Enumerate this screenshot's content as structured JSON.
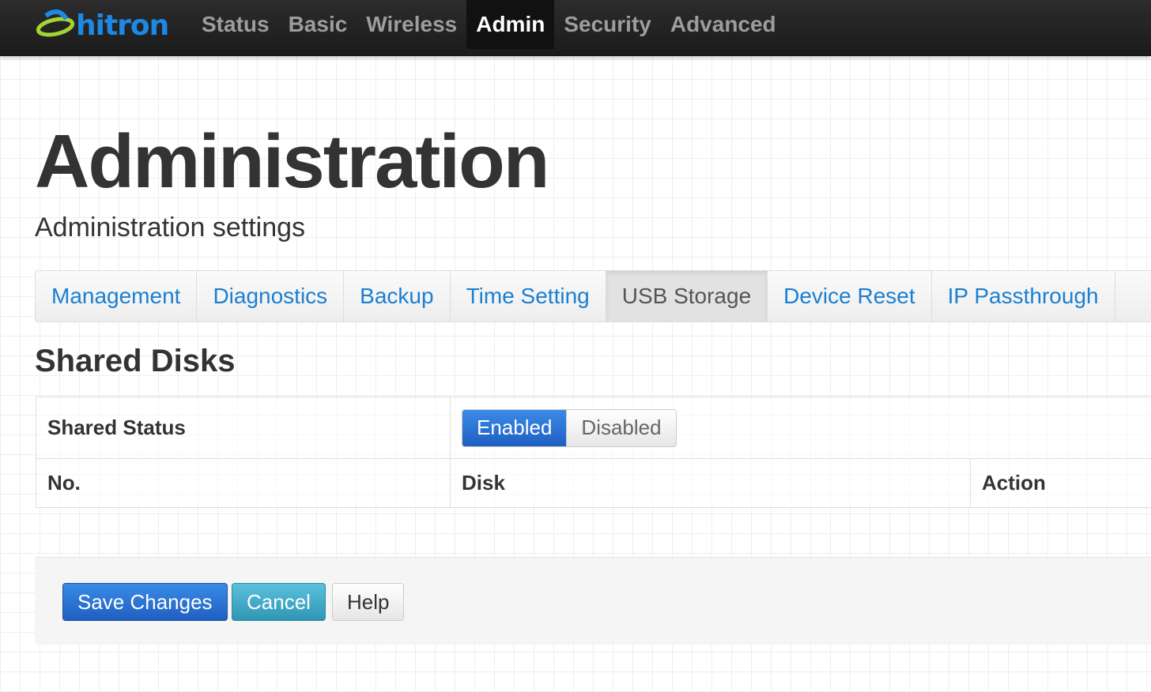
{
  "brand": {
    "name": "hitron",
    "color": "#1e88e5",
    "accent": "#a4d433"
  },
  "nav": {
    "items": [
      {
        "label": "Status",
        "active": false
      },
      {
        "label": "Basic",
        "active": false
      },
      {
        "label": "Wireless",
        "active": false
      },
      {
        "label": "Admin",
        "active": true
      },
      {
        "label": "Security",
        "active": false
      },
      {
        "label": "Advanced",
        "active": false
      }
    ]
  },
  "page": {
    "title": "Administration",
    "subtitle": "Administration settings"
  },
  "tabs": {
    "items": [
      {
        "label": "Management",
        "active": false
      },
      {
        "label": "Diagnostics",
        "active": false
      },
      {
        "label": "Backup",
        "active": false
      },
      {
        "label": "Time Setting",
        "active": false
      },
      {
        "label": "USB Storage",
        "active": true
      },
      {
        "label": "Device Reset",
        "active": false
      },
      {
        "label": "IP Passthrough",
        "active": false
      }
    ]
  },
  "shared_disks": {
    "title": "Shared Disks",
    "status_label": "Shared Status",
    "toggle": {
      "enabled_label": "Enabled",
      "disabled_label": "Disabled",
      "selected": "Enabled"
    },
    "columns": [
      "No.",
      "Disk",
      "Action"
    ]
  },
  "actions": {
    "save_label": "Save Changes",
    "cancel_label": "Cancel",
    "help_label": "Help"
  }
}
